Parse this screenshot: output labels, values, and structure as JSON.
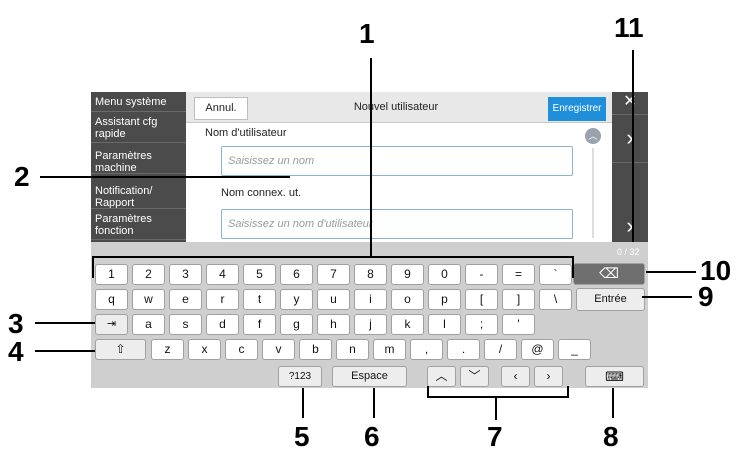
{
  "sidebar": {
    "items": [
      {
        "label": "Menu système"
      },
      {
        "label": "Assistant cfg rapide"
      },
      {
        "label": "Paramètres machine"
      },
      {
        "label": "Notification/ Rapport"
      },
      {
        "label": "Paramètres fonction"
      }
    ]
  },
  "dialog": {
    "cancel_label": "Annul.",
    "title": "Nouvel utilisateur",
    "save_label": "Enregistrer",
    "user_name_label": "Nom d'utilisateur",
    "user_name_placeholder": "Saisissez un nom",
    "login_name_label": "Nom connex. ut.",
    "login_name_placeholder": "Saisissez un nom d'utilisateur",
    "char_counter": "0 / 32"
  },
  "keyboard": {
    "row1": [
      "1",
      "2",
      "3",
      "4",
      "5",
      "6",
      "7",
      "8",
      "9",
      "0",
      "-",
      "=",
      "`"
    ],
    "row2": [
      "q",
      "w",
      "e",
      "r",
      "t",
      "y",
      "u",
      "i",
      "o",
      "p",
      "[",
      "]",
      "\\"
    ],
    "row3": [
      "a",
      "s",
      "d",
      "f",
      "g",
      "h",
      "j",
      "k",
      "l",
      ";",
      "'"
    ],
    "row4": [
      "z",
      "x",
      "c",
      "v",
      "b",
      "n",
      "m",
      ",",
      ".",
      "/",
      "@",
      "_"
    ],
    "enter_label": "Entrée",
    "numbers_label": "?123",
    "space_label": "Espace"
  },
  "callouts": [
    "1",
    "2",
    "3",
    "4",
    "5",
    "6",
    "7",
    "8",
    "9",
    "10",
    "11"
  ],
  "colors": {
    "accent": "#1f8fdc",
    "panel": "#4b4b4b",
    "keyboard_bg": "#cfcfcf"
  }
}
